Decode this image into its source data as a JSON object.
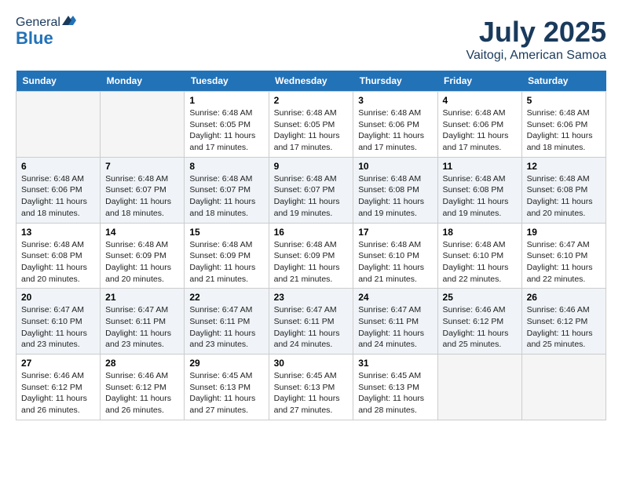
{
  "logo": {
    "general": "General",
    "blue": "Blue"
  },
  "header": {
    "month": "July 2025",
    "location": "Vaitogi, American Samoa"
  },
  "weekdays": [
    "Sunday",
    "Monday",
    "Tuesday",
    "Wednesday",
    "Thursday",
    "Friday",
    "Saturday"
  ],
  "weeks": [
    [
      {
        "day": "",
        "info": ""
      },
      {
        "day": "",
        "info": ""
      },
      {
        "day": "1",
        "info": "Sunrise: 6:48 AM\nSunset: 6:05 PM\nDaylight: 11 hours and 17 minutes."
      },
      {
        "day": "2",
        "info": "Sunrise: 6:48 AM\nSunset: 6:05 PM\nDaylight: 11 hours and 17 minutes."
      },
      {
        "day": "3",
        "info": "Sunrise: 6:48 AM\nSunset: 6:06 PM\nDaylight: 11 hours and 17 minutes."
      },
      {
        "day": "4",
        "info": "Sunrise: 6:48 AM\nSunset: 6:06 PM\nDaylight: 11 hours and 17 minutes."
      },
      {
        "day": "5",
        "info": "Sunrise: 6:48 AM\nSunset: 6:06 PM\nDaylight: 11 hours and 18 minutes."
      }
    ],
    [
      {
        "day": "6",
        "info": "Sunrise: 6:48 AM\nSunset: 6:06 PM\nDaylight: 11 hours and 18 minutes."
      },
      {
        "day": "7",
        "info": "Sunrise: 6:48 AM\nSunset: 6:07 PM\nDaylight: 11 hours and 18 minutes."
      },
      {
        "day": "8",
        "info": "Sunrise: 6:48 AM\nSunset: 6:07 PM\nDaylight: 11 hours and 18 minutes."
      },
      {
        "day": "9",
        "info": "Sunrise: 6:48 AM\nSunset: 6:07 PM\nDaylight: 11 hours and 19 minutes."
      },
      {
        "day": "10",
        "info": "Sunrise: 6:48 AM\nSunset: 6:08 PM\nDaylight: 11 hours and 19 minutes."
      },
      {
        "day": "11",
        "info": "Sunrise: 6:48 AM\nSunset: 6:08 PM\nDaylight: 11 hours and 19 minutes."
      },
      {
        "day": "12",
        "info": "Sunrise: 6:48 AM\nSunset: 6:08 PM\nDaylight: 11 hours and 20 minutes."
      }
    ],
    [
      {
        "day": "13",
        "info": "Sunrise: 6:48 AM\nSunset: 6:08 PM\nDaylight: 11 hours and 20 minutes."
      },
      {
        "day": "14",
        "info": "Sunrise: 6:48 AM\nSunset: 6:09 PM\nDaylight: 11 hours and 20 minutes."
      },
      {
        "day": "15",
        "info": "Sunrise: 6:48 AM\nSunset: 6:09 PM\nDaylight: 11 hours and 21 minutes."
      },
      {
        "day": "16",
        "info": "Sunrise: 6:48 AM\nSunset: 6:09 PM\nDaylight: 11 hours and 21 minutes."
      },
      {
        "day": "17",
        "info": "Sunrise: 6:48 AM\nSunset: 6:10 PM\nDaylight: 11 hours and 21 minutes."
      },
      {
        "day": "18",
        "info": "Sunrise: 6:48 AM\nSunset: 6:10 PM\nDaylight: 11 hours and 22 minutes."
      },
      {
        "day": "19",
        "info": "Sunrise: 6:47 AM\nSunset: 6:10 PM\nDaylight: 11 hours and 22 minutes."
      }
    ],
    [
      {
        "day": "20",
        "info": "Sunrise: 6:47 AM\nSunset: 6:10 PM\nDaylight: 11 hours and 23 minutes."
      },
      {
        "day": "21",
        "info": "Sunrise: 6:47 AM\nSunset: 6:11 PM\nDaylight: 11 hours and 23 minutes."
      },
      {
        "day": "22",
        "info": "Sunrise: 6:47 AM\nSunset: 6:11 PM\nDaylight: 11 hours and 23 minutes."
      },
      {
        "day": "23",
        "info": "Sunrise: 6:47 AM\nSunset: 6:11 PM\nDaylight: 11 hours and 24 minutes."
      },
      {
        "day": "24",
        "info": "Sunrise: 6:47 AM\nSunset: 6:11 PM\nDaylight: 11 hours and 24 minutes."
      },
      {
        "day": "25",
        "info": "Sunrise: 6:46 AM\nSunset: 6:12 PM\nDaylight: 11 hours and 25 minutes."
      },
      {
        "day": "26",
        "info": "Sunrise: 6:46 AM\nSunset: 6:12 PM\nDaylight: 11 hours and 25 minutes."
      }
    ],
    [
      {
        "day": "27",
        "info": "Sunrise: 6:46 AM\nSunset: 6:12 PM\nDaylight: 11 hours and 26 minutes."
      },
      {
        "day": "28",
        "info": "Sunrise: 6:46 AM\nSunset: 6:12 PM\nDaylight: 11 hours and 26 minutes."
      },
      {
        "day": "29",
        "info": "Sunrise: 6:45 AM\nSunset: 6:13 PM\nDaylight: 11 hours and 27 minutes."
      },
      {
        "day": "30",
        "info": "Sunrise: 6:45 AM\nSunset: 6:13 PM\nDaylight: 11 hours and 27 minutes."
      },
      {
        "day": "31",
        "info": "Sunrise: 6:45 AM\nSunset: 6:13 PM\nDaylight: 11 hours and 28 minutes."
      },
      {
        "day": "",
        "info": ""
      },
      {
        "day": "",
        "info": ""
      }
    ]
  ]
}
